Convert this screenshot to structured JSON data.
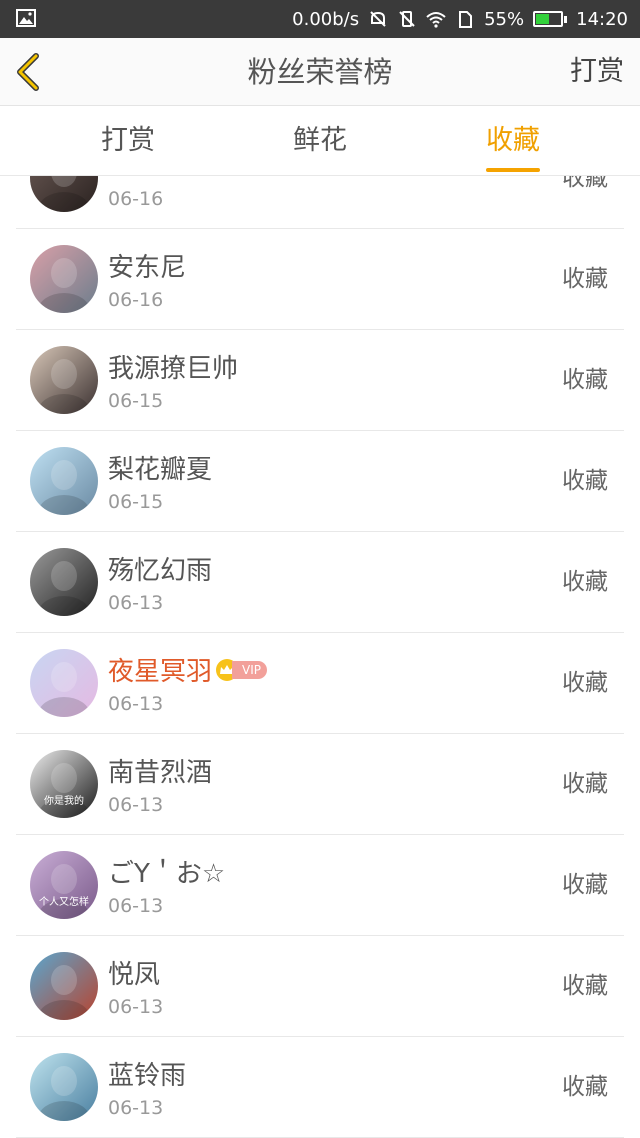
{
  "status": {
    "speed": "0.00b/s",
    "battery": "55%",
    "battery_level": 0.55,
    "time": "14:20"
  },
  "nav": {
    "title": "粉丝荣誉榜",
    "action": "打赏"
  },
  "tabs": [
    {
      "label": "打赏",
      "active": false
    },
    {
      "label": "鲜花",
      "active": false
    },
    {
      "label": "收藏",
      "active": true
    }
  ],
  "rows": [
    {
      "name": "",
      "date": "06-16",
      "action": "收藏",
      "colors": [
        "#6b5a55",
        "#2a2220"
      ]
    },
    {
      "name": "安东尼",
      "date": "06-16",
      "action": "收藏",
      "colors": [
        "#d9a0a8",
        "#6b7d8c"
      ]
    },
    {
      "name": "我源撩巨帅",
      "date": "06-15",
      "action": "收藏",
      "colors": [
        "#d8c7b8",
        "#3a3030"
      ]
    },
    {
      "name": "梨花瓣夏",
      "date": "06-15",
      "action": "收藏",
      "colors": [
        "#bfe0f2",
        "#6a8aa3"
      ]
    },
    {
      "name": "殇忆幻雨",
      "date": "06-13",
      "action": "收藏",
      "colors": [
        "#9a9a9a",
        "#222222"
      ]
    },
    {
      "name": "夜星冥羽",
      "date": "06-13",
      "action": "收藏",
      "vip": true,
      "vip_label": "VIP",
      "colors": [
        "#c8d6f2",
        "#e5b9e2"
      ]
    },
    {
      "name": "南昔烈酒",
      "date": "06-13",
      "action": "收藏",
      "caption": "你是我的",
      "colors": [
        "#eeeeee",
        "#1a1a1a"
      ]
    },
    {
      "name": "ごY＇お☆",
      "date": "06-13",
      "action": "收藏",
      "caption": "个人又怎样",
      "colors": [
        "#c9aed6",
        "#7a5a8a"
      ]
    },
    {
      "name": "悦凤",
      "date": "06-13",
      "action": "收藏",
      "colors": [
        "#5aa7cf",
        "#b8432e"
      ]
    },
    {
      "name": "蓝铃雨",
      "date": "06-13",
      "action": "收藏",
      "colors": [
        "#bfe3ee",
        "#4a7fa0"
      ]
    }
  ]
}
